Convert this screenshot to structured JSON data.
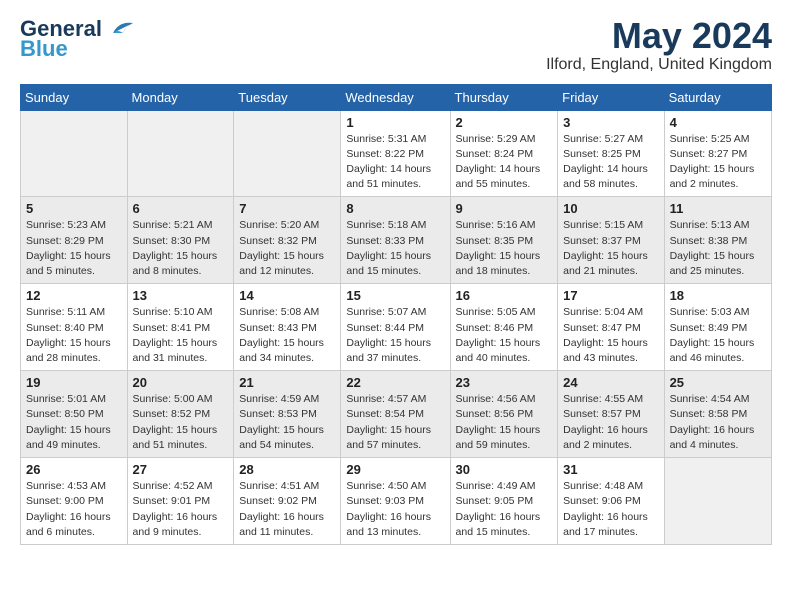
{
  "header": {
    "logo_line1": "General",
    "logo_line2": "Blue",
    "month": "May 2024",
    "location": "Ilford, England, United Kingdom"
  },
  "weekdays": [
    "Sunday",
    "Monday",
    "Tuesday",
    "Wednesday",
    "Thursday",
    "Friday",
    "Saturday"
  ],
  "weeks": [
    [
      {
        "day": "",
        "info": ""
      },
      {
        "day": "",
        "info": ""
      },
      {
        "day": "",
        "info": ""
      },
      {
        "day": "1",
        "info": "Sunrise: 5:31 AM\nSunset: 8:22 PM\nDaylight: 14 hours\nand 51 minutes."
      },
      {
        "day": "2",
        "info": "Sunrise: 5:29 AM\nSunset: 8:24 PM\nDaylight: 14 hours\nand 55 minutes."
      },
      {
        "day": "3",
        "info": "Sunrise: 5:27 AM\nSunset: 8:25 PM\nDaylight: 14 hours\nand 58 minutes."
      },
      {
        "day": "4",
        "info": "Sunrise: 5:25 AM\nSunset: 8:27 PM\nDaylight: 15 hours\nand 2 minutes."
      }
    ],
    [
      {
        "day": "5",
        "info": "Sunrise: 5:23 AM\nSunset: 8:29 PM\nDaylight: 15 hours\nand 5 minutes."
      },
      {
        "day": "6",
        "info": "Sunrise: 5:21 AM\nSunset: 8:30 PM\nDaylight: 15 hours\nand 8 minutes."
      },
      {
        "day": "7",
        "info": "Sunrise: 5:20 AM\nSunset: 8:32 PM\nDaylight: 15 hours\nand 12 minutes."
      },
      {
        "day": "8",
        "info": "Sunrise: 5:18 AM\nSunset: 8:33 PM\nDaylight: 15 hours\nand 15 minutes."
      },
      {
        "day": "9",
        "info": "Sunrise: 5:16 AM\nSunset: 8:35 PM\nDaylight: 15 hours\nand 18 minutes."
      },
      {
        "day": "10",
        "info": "Sunrise: 5:15 AM\nSunset: 8:37 PM\nDaylight: 15 hours\nand 21 minutes."
      },
      {
        "day": "11",
        "info": "Sunrise: 5:13 AM\nSunset: 8:38 PM\nDaylight: 15 hours\nand 25 minutes."
      }
    ],
    [
      {
        "day": "12",
        "info": "Sunrise: 5:11 AM\nSunset: 8:40 PM\nDaylight: 15 hours\nand 28 minutes."
      },
      {
        "day": "13",
        "info": "Sunrise: 5:10 AM\nSunset: 8:41 PM\nDaylight: 15 hours\nand 31 minutes."
      },
      {
        "day": "14",
        "info": "Sunrise: 5:08 AM\nSunset: 8:43 PM\nDaylight: 15 hours\nand 34 minutes."
      },
      {
        "day": "15",
        "info": "Sunrise: 5:07 AM\nSunset: 8:44 PM\nDaylight: 15 hours\nand 37 minutes."
      },
      {
        "day": "16",
        "info": "Sunrise: 5:05 AM\nSunset: 8:46 PM\nDaylight: 15 hours\nand 40 minutes."
      },
      {
        "day": "17",
        "info": "Sunrise: 5:04 AM\nSunset: 8:47 PM\nDaylight: 15 hours\nand 43 minutes."
      },
      {
        "day": "18",
        "info": "Sunrise: 5:03 AM\nSunset: 8:49 PM\nDaylight: 15 hours\nand 46 minutes."
      }
    ],
    [
      {
        "day": "19",
        "info": "Sunrise: 5:01 AM\nSunset: 8:50 PM\nDaylight: 15 hours\nand 49 minutes."
      },
      {
        "day": "20",
        "info": "Sunrise: 5:00 AM\nSunset: 8:52 PM\nDaylight: 15 hours\nand 51 minutes."
      },
      {
        "day": "21",
        "info": "Sunrise: 4:59 AM\nSunset: 8:53 PM\nDaylight: 15 hours\nand 54 minutes."
      },
      {
        "day": "22",
        "info": "Sunrise: 4:57 AM\nSunset: 8:54 PM\nDaylight: 15 hours\nand 57 minutes."
      },
      {
        "day": "23",
        "info": "Sunrise: 4:56 AM\nSunset: 8:56 PM\nDaylight: 15 hours\nand 59 minutes."
      },
      {
        "day": "24",
        "info": "Sunrise: 4:55 AM\nSunset: 8:57 PM\nDaylight: 16 hours\nand 2 minutes."
      },
      {
        "day": "25",
        "info": "Sunrise: 4:54 AM\nSunset: 8:58 PM\nDaylight: 16 hours\nand 4 minutes."
      }
    ],
    [
      {
        "day": "26",
        "info": "Sunrise: 4:53 AM\nSunset: 9:00 PM\nDaylight: 16 hours\nand 6 minutes."
      },
      {
        "day": "27",
        "info": "Sunrise: 4:52 AM\nSunset: 9:01 PM\nDaylight: 16 hours\nand 9 minutes."
      },
      {
        "day": "28",
        "info": "Sunrise: 4:51 AM\nSunset: 9:02 PM\nDaylight: 16 hours\nand 11 minutes."
      },
      {
        "day": "29",
        "info": "Sunrise: 4:50 AM\nSunset: 9:03 PM\nDaylight: 16 hours\nand 13 minutes."
      },
      {
        "day": "30",
        "info": "Sunrise: 4:49 AM\nSunset: 9:05 PM\nDaylight: 16 hours\nand 15 minutes."
      },
      {
        "day": "31",
        "info": "Sunrise: 4:48 AM\nSunset: 9:06 PM\nDaylight: 16 hours\nand 17 minutes."
      },
      {
        "day": "",
        "info": ""
      }
    ]
  ]
}
